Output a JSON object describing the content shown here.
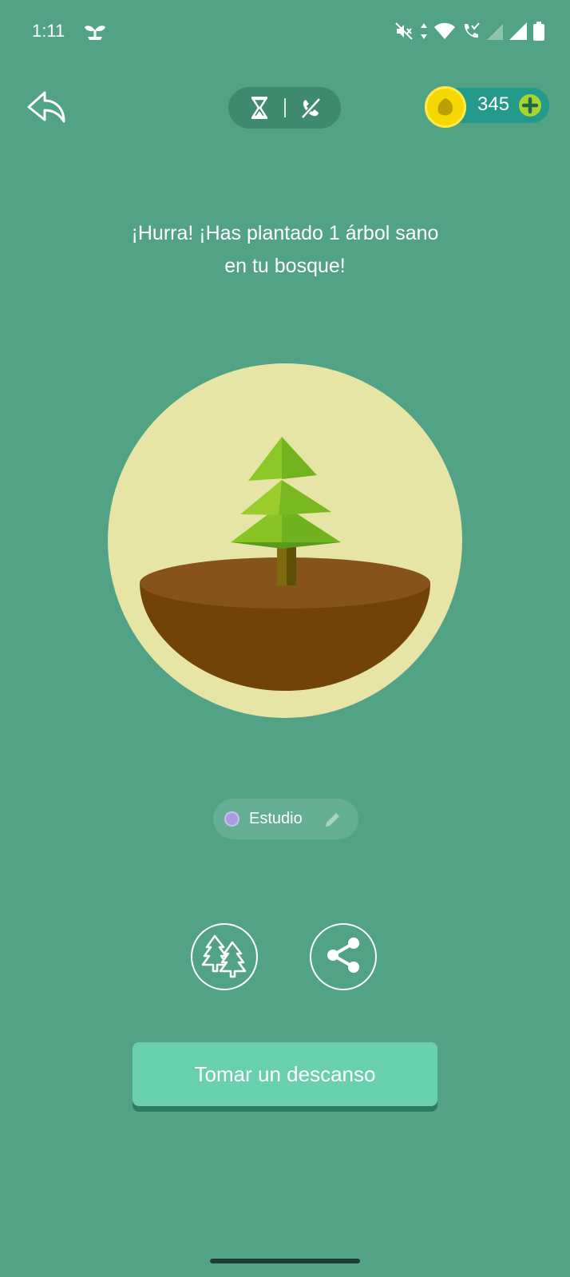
{
  "status_bar": {
    "time": "1:11",
    "icons": [
      "sprout-icon",
      "mute-icon",
      "data-arrows-icon",
      "wifi-icon",
      "wifi-call-icon",
      "signal-icon",
      "battery-icon"
    ]
  },
  "header": {
    "back_icon": "back-arrow-icon",
    "modes": [
      "hourglass-icon",
      "no-phone-icon"
    ],
    "coin_count": "345"
  },
  "message": {
    "line1": "¡Hurra! ¡Has plantado 1 árbol sano",
    "line2": "en tu bosque!"
  },
  "tag": {
    "label": "Estudio",
    "color": "#a89be0"
  },
  "actions": {
    "forest_icon": "forest-icon",
    "share_icon": "share-icon",
    "break_button": "Tomar un descanso"
  },
  "colors": {
    "background": "#52a386",
    "button": "#69d0ad",
    "coin": "#f5d800",
    "circle": "#e6e5a6"
  }
}
